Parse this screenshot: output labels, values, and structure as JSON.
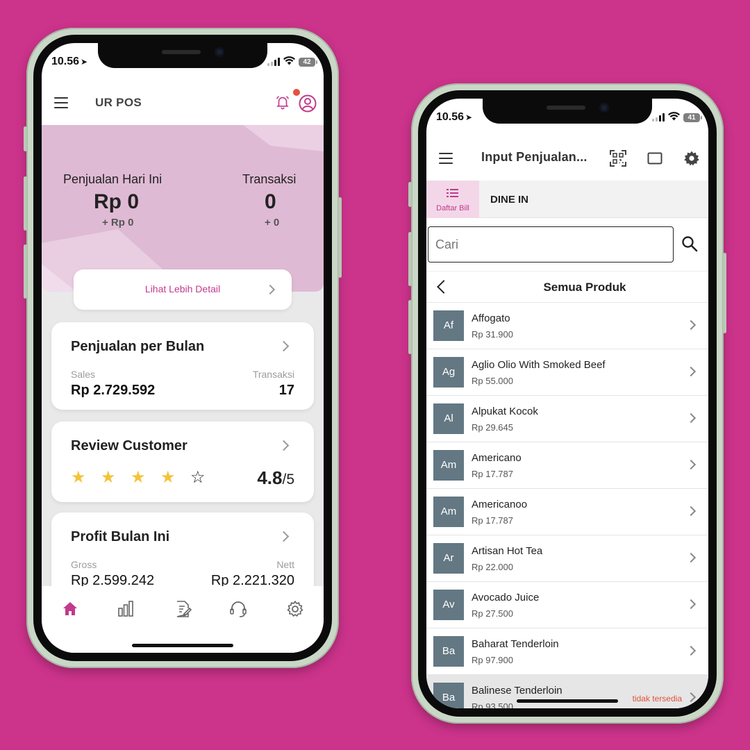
{
  "left": {
    "status_time": "10.56",
    "battery": "42",
    "app_title": "UR POS",
    "today_sales_label": "Penjualan Hari Ini",
    "today_sales_value": "Rp 0",
    "today_sales_delta": "+ Rp 0",
    "transactions_label": "Transaksi",
    "transactions_value": "0",
    "transactions_delta": "+ 0",
    "detail_button": "Lihat Lebih Detail",
    "monthly": {
      "title": "Penjualan per Bulan",
      "sales_label": "Sales",
      "sales_value": "Rp 2.729.592",
      "trx_label": "Transaksi",
      "trx_value": "17"
    },
    "review": {
      "title": "Review Customer",
      "rating": "4.8",
      "rating_max": "/5",
      "stars_filled": 4,
      "stars_total": 5
    },
    "profit": {
      "title": "Profit Bulan Ini",
      "gross_label": "Gross",
      "gross_value": "Rp 2.599.242",
      "nett_label": "Nett",
      "nett_value": "Rp 2.221.320"
    },
    "nav_icons": [
      "home-icon",
      "chart-icon",
      "report-icon",
      "support-icon",
      "settings-icon"
    ]
  },
  "right": {
    "status_time": "10.56",
    "battery": "41",
    "title": "Input Penjualan...",
    "tab_bill": "Daftar Bill",
    "tab_dine": "DINE IN",
    "search_placeholder": "Cari",
    "section_title": "Semua Produk",
    "unavailable_label": "tidak tersedia",
    "products": [
      {
        "abbr": "Af",
        "name": "Affogato",
        "price": "Rp 31.900"
      },
      {
        "abbr": "Ag",
        "name": "Aglio Olio With Smoked Beef",
        "price": "Rp 55.000"
      },
      {
        "abbr": "Al",
        "name": "Alpukat Kocok",
        "price": "Rp 29.645"
      },
      {
        "abbr": "Am",
        "name": "Americano",
        "price": "Rp 17.787"
      },
      {
        "abbr": "Am",
        "name": "Americanoo",
        "price": "Rp 17.787"
      },
      {
        "abbr": "Ar",
        "name": "Artisan Hot Tea",
        "price": "Rp 22.000"
      },
      {
        "abbr": "Av",
        "name": "Avocado Juice",
        "price": "Rp 27.500"
      },
      {
        "abbr": "Ba",
        "name": "Baharat Tenderloin",
        "price": "Rp 97.900"
      },
      {
        "abbr": "Ba",
        "name": "Balinese Tenderloin",
        "price": "Rp 93.500"
      }
    ]
  },
  "colors": {
    "background": "#cc338b",
    "accent": "#c23a8c",
    "banner": "#dfbad4",
    "star": "#f4c338",
    "thumb": "#637883",
    "alert": "#e4513c"
  }
}
